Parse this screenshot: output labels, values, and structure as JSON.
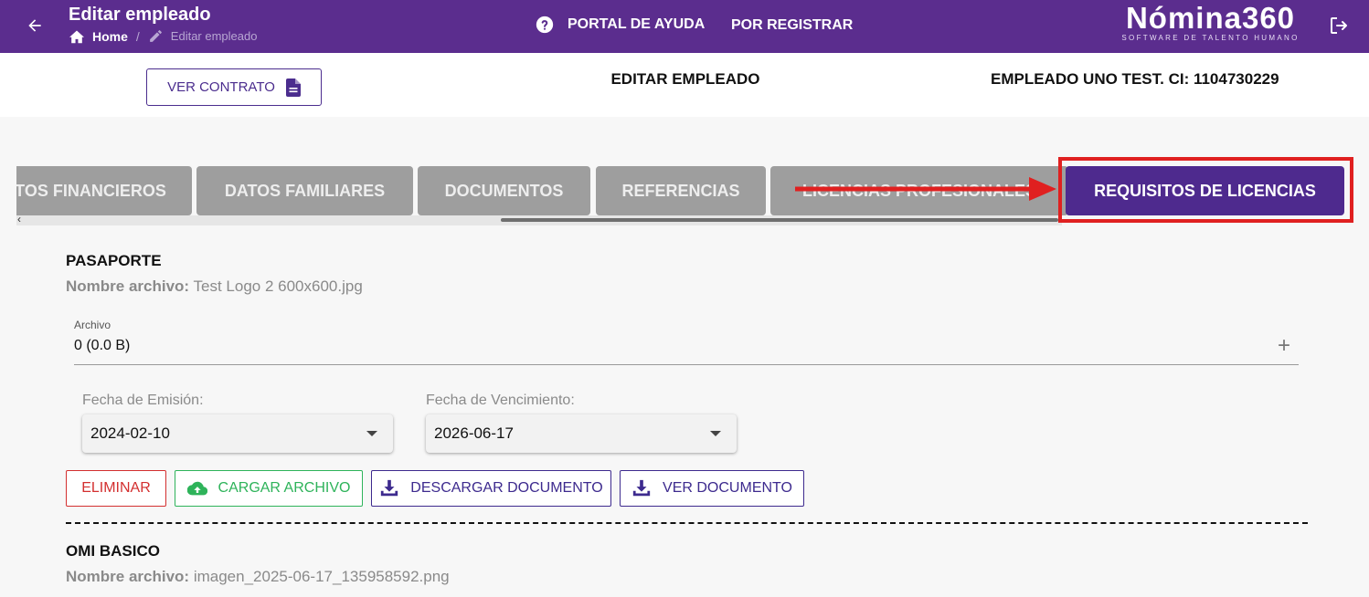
{
  "topbar": {
    "title": "Editar empleado",
    "breadcrumb_home": "Home",
    "breadcrumb_sep": "/",
    "breadcrumb_current": "Editar empleado",
    "help_link": "PORTAL DE AYUDA",
    "register_link": "POR REGISTRAR",
    "brand_name": "Nómina360",
    "brand_tagline": "SOFTWARE DE TALENTO HUMANO",
    "icons": [
      "arrow-left-icon",
      "home-icon",
      "pencil-icon",
      "help-circle-icon",
      "logout-icon"
    ]
  },
  "header": {
    "ver_contrato": "VER CONTRATO",
    "title": "EDITAR EMPLEADO",
    "employee": "EMPLEADO UNO TEST. CI: 1104730229"
  },
  "tabs": [
    {
      "label": "TOS FINANCIEROS",
      "active": false
    },
    {
      "label": "DATOS FAMILIARES",
      "active": false
    },
    {
      "label": "DOCUMENTOS",
      "active": false
    },
    {
      "label": "REFERENCIAS",
      "active": false
    },
    {
      "label": "LICENCIAS PROFESIONALES",
      "active": false
    },
    {
      "label": "REQUISITOS DE LICENCIAS",
      "active": true
    }
  ],
  "scroll_left": "‹",
  "documents": [
    {
      "title": "PASAPORTE",
      "file_label": "Nombre archivo:",
      "file_name": "Test Logo 2 600x600.jpg",
      "archivo_label": "Archivo",
      "archivo_value": "0 (0.0 B)",
      "archivo_add": "+",
      "emission_label": "Fecha de Emisión:",
      "emission_value": "2024-02-10",
      "expiry_label": "Fecha de Vencimiento:",
      "expiry_value": "2026-06-17"
    },
    {
      "title": "OMI BASICO",
      "file_label": "Nombre archivo:",
      "file_name": "imagen_2025-06-17_135958592.png"
    }
  ],
  "actions": {
    "delete": "ELIMINAR",
    "upload": "CARGAR ARCHIVO",
    "download": "DESCARGAR DOCUMENTO",
    "view": "VER DOCUMENTO"
  },
  "colors": {
    "brand_purple": "#5b2d8e",
    "active_tab": "#4e2a8e",
    "inactive_tab": "#9e9e9e",
    "annotation_red": "#e02020",
    "delete_red": "#d32f2f",
    "upload_green": "#2eb35a"
  }
}
